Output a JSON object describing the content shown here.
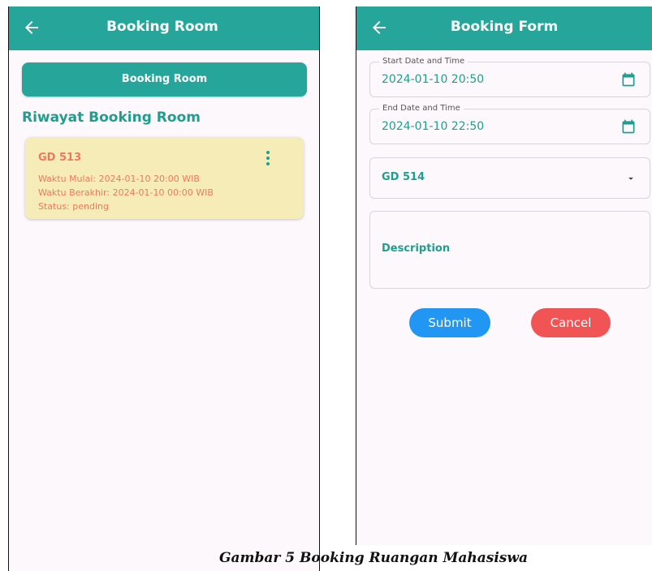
{
  "left": {
    "appbar_title": "Booking Room",
    "booking_button": "Booking Room",
    "history_title": "Riwayat Booking Room",
    "card": {
      "room": "GD 513",
      "start": "Waktu Mulai: 2024-01-10 20:00 WIB",
      "end": "Waktu Berakhir: 2024-01-10 00:00 WIB",
      "status": "Status: pending"
    }
  },
  "right": {
    "appbar_title": "Booking Form",
    "start_label": "Start Date and Time",
    "start_value": "2024-01-10 20:50",
    "end_label": "End Date and Time",
    "end_value": "2024-01-10 22:50",
    "room_value": "GD 514",
    "description_label": "Description",
    "submit_label": "Submit",
    "cancel_label": "Cancel"
  },
  "caption": "Gambar 5 Booking Ruangan Mahasiswa",
  "colors": {
    "primary": "#26a69a",
    "card_bg": "#f6ecb8",
    "card_text": "#ec7a5c",
    "submit": "#2196f3",
    "cancel": "#f05454"
  },
  "icons": [
    "back-arrow-icon",
    "more-vert-icon",
    "calendar-icon",
    "dropdown-arrow-icon"
  ]
}
